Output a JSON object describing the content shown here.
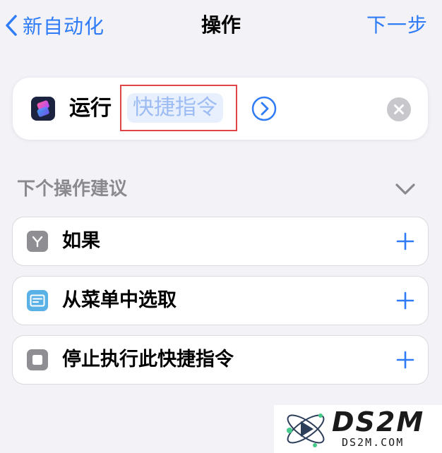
{
  "nav": {
    "back_label": "新自动化",
    "title": "操作",
    "next_label": "下一步"
  },
  "action": {
    "verb": "运行",
    "shortcut_placeholder": "快捷指令",
    "app_icon": "shortcuts-app-icon",
    "chevron_icon": "chevron-right-circle-icon",
    "clear_icon": "clear-circle-icon"
  },
  "suggestions": {
    "title": "下个操作建议",
    "items": [
      {
        "label": "如果",
        "icon": "branch-icon",
        "icon_color": "#8e8e93"
      },
      {
        "label": "从菜单中选取",
        "icon": "menu-list-icon",
        "icon_color": "#5ab1e6"
      },
      {
        "label": "停止执行此快捷指令",
        "icon": "stop-square-icon",
        "icon_color": "#8e8e93"
      }
    ]
  },
  "colors": {
    "accent": "#2f7cf6",
    "highlight_border": "#e14646",
    "background": "#f2f2f7"
  },
  "watermark": {
    "brand": "DS2M",
    "domain": "DS2M.COM"
  }
}
